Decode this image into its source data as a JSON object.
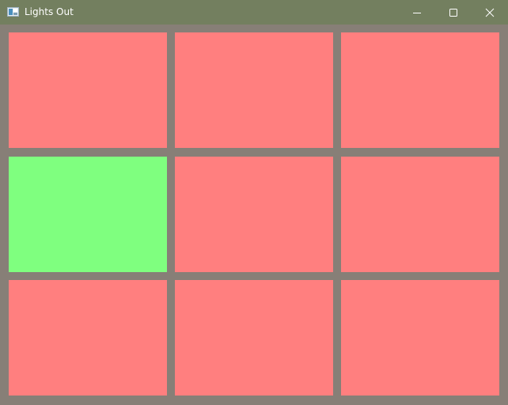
{
  "window": {
    "title": "Lights Out",
    "icon": "app-window-icon",
    "controls": {
      "minimize_icon": "minimize-icon",
      "maximize_icon": "maximize-icon",
      "close_icon": "close-icon"
    }
  },
  "colors": {
    "background": "#877f77",
    "titlebar": "#737f5f",
    "off": "#ff7f7f",
    "on": "#7fff7f"
  },
  "board": {
    "rows": 3,
    "cols": 3,
    "cells": [
      [
        false,
        false,
        false
      ],
      [
        true,
        false,
        false
      ],
      [
        false,
        false,
        false
      ]
    ]
  }
}
